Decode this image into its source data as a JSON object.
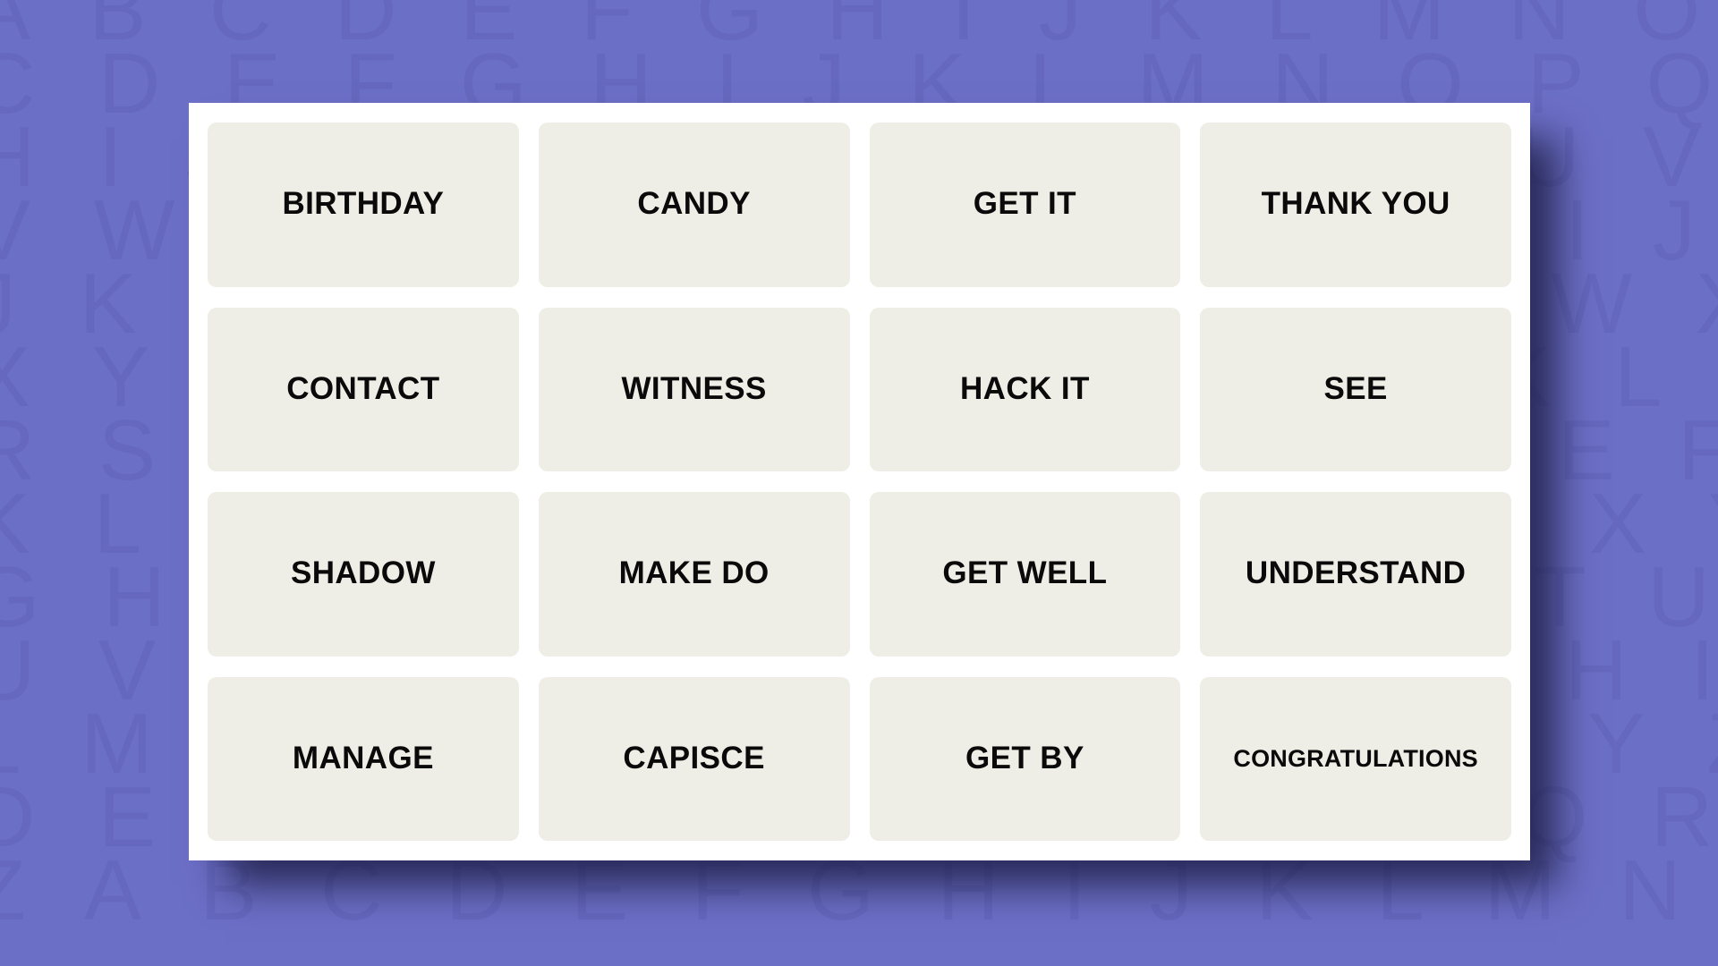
{
  "background": {
    "color": "#6C6FC6",
    "letter_color": "#6568BE",
    "rows": [
      "A B C D E F G H I J K L M N O P Q R S T U V W X Y Z A B C D E F",
      "C D E F G H I J K L M N O P Q R S T U V W X Y Z A B C D E F G H",
      "H I J K L M N O P Q R S T U V W X Y Z A B C D E F G H I J K L M",
      "V W X Y Z A B C D E F G H I J K L M N O P Q R S T U V W X Y Z A",
      "J K L M N O P Q R S T U V W X Y Z A B C D E F G H I J K L M N O",
      "X Y Z A B C D E F G H I J K L M N O P Q R S T U V W X Y Z A B C",
      "R S T U V W X Y Z A B C D E F G H I J K L M N O P Q R S T U V W",
      "K L M N O P Q R S T U V W X Y Z A B C D E F G H I J K L M N O P",
      "G H I J K L M N O P Q R S T U V W X Y Z A B C D E F G H I J K L",
      "U V W X Y Z A B C D E F G H I J K L M N O P Q R S T U V W X Y Z",
      "L M N O P Q R S T U V W X Y Z A B C D E F G H I J K L M N O P Q",
      "D E F G H I J K L M N O P Q R S T U V W X Y Z A B C D E F G H I",
      "Z A B C D E F G H I J K L M N O P Q R S T U V W X Y Z A B C D E"
    ]
  },
  "board": {
    "card_color": "#FFFFFF",
    "tile_color": "#EFEEE6",
    "tile_text_color": "#0A0A0A",
    "columns": 4,
    "rows": 4,
    "tiles": [
      {
        "label": "BIRTHDAY",
        "size": "normal"
      },
      {
        "label": "CANDY",
        "size": "normal"
      },
      {
        "label": "GET IT",
        "size": "normal"
      },
      {
        "label": "THANK YOU",
        "size": "normal"
      },
      {
        "label": "CONTACT",
        "size": "normal"
      },
      {
        "label": "WITNESS",
        "size": "normal"
      },
      {
        "label": "HACK IT",
        "size": "normal"
      },
      {
        "label": "SEE",
        "size": "normal"
      },
      {
        "label": "SHADOW",
        "size": "normal"
      },
      {
        "label": "MAKE DO",
        "size": "normal"
      },
      {
        "label": "GET WELL",
        "size": "normal"
      },
      {
        "label": "UNDERSTAND",
        "size": "normal"
      },
      {
        "label": "MANAGE",
        "size": "normal"
      },
      {
        "label": "CAPISCE",
        "size": "normal"
      },
      {
        "label": "GET BY",
        "size": "normal"
      },
      {
        "label": "CONGRATULATIONS",
        "size": "tight"
      }
    ]
  }
}
